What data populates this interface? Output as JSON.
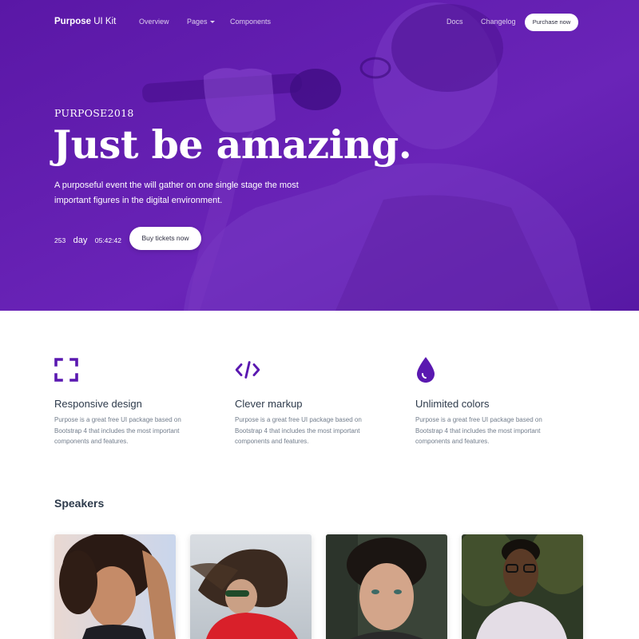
{
  "nav": {
    "brand_bold": "Purpose",
    "brand_rest": " UI Kit",
    "overview": "Overview",
    "pages": "Pages",
    "components": "Components",
    "docs": "Docs",
    "changelog": "Changelog",
    "purchase": "Purchase now"
  },
  "hero": {
    "eyebrow": "PURPOSE2018",
    "headline": "Just be amazing.",
    "lead": "A purposeful event the will gather on one single stage the most important figures in the digital environment.",
    "countdown": {
      "days": "253",
      "unit": "day",
      "time": "05:42:42"
    },
    "cta": "Buy tickets now"
  },
  "features": [
    {
      "icon": "expand-icon",
      "title": "Responsive design",
      "desc": "Purpose is a great free UI package based on Bootstrap 4 that includes the most important components and features."
    },
    {
      "icon": "code-icon",
      "title": "Clever markup",
      "desc": "Purpose is a great free UI package based on Bootstrap 4 that includes the most important components and features."
    },
    {
      "icon": "drop-icon",
      "title": "Unlimited colors",
      "desc": "Purpose is a great free UI package based on Bootstrap 4 that includes the most important components and features."
    }
  ],
  "speakers": {
    "title": "Speakers"
  },
  "colors": {
    "primary": "#5b1aa8",
    "icon": "#5a18b0",
    "text_dark": "#2d3a4b",
    "text_muted": "#727d8c"
  }
}
